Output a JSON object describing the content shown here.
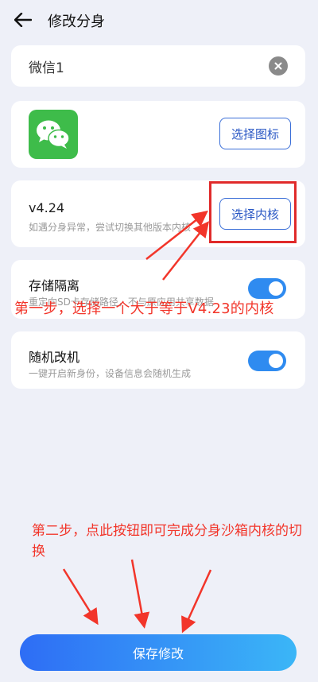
{
  "header": {
    "title": "修改分身"
  },
  "name_field": {
    "value": "微信1"
  },
  "icon_section": {
    "choose_label": "选择图标"
  },
  "core_section": {
    "version": "v4.24",
    "hint": "如遇分身异常，尝试切换其他版本内核",
    "choose_label": "选择内核"
  },
  "storage_section": {
    "title": "存储隔离",
    "description": "重定向SD卡存储路径，不与原应用共享数据",
    "enabled": true
  },
  "random_section": {
    "title": "随机改机",
    "description": "一键开启新身份，设备信息会随机生成",
    "enabled": true
  },
  "annotations": {
    "step1": "第一步，选择一个大于等于V4.23的内核",
    "step2": "第二步，点此按钮即可完成分身沙箱内核的切换"
  },
  "footer": {
    "save_label": "保存修改"
  },
  "colors": {
    "accent": "#2f8bf0",
    "annotation": "#f2352a",
    "wechat_green": "#3ebc4a"
  }
}
